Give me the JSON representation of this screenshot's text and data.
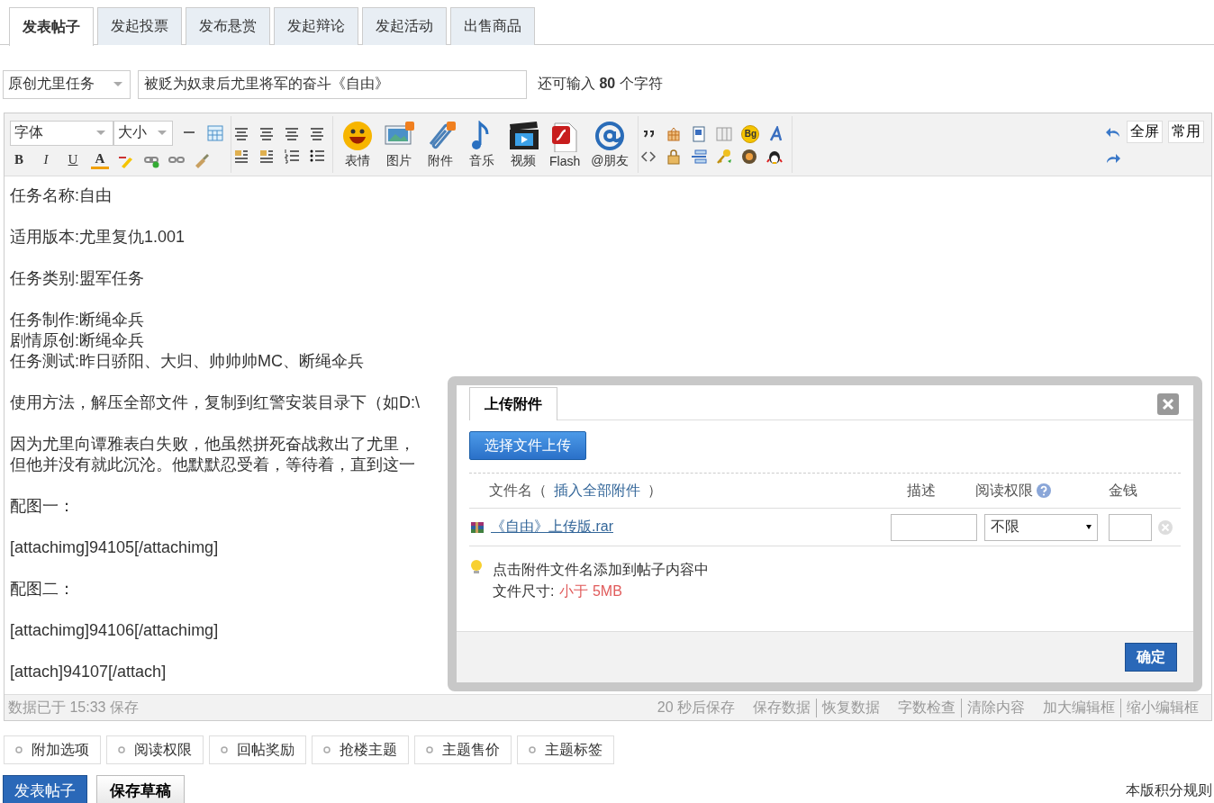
{
  "tabs": [
    {
      "label": "发表帖子",
      "selected": true
    },
    {
      "label": "发起投票",
      "selected": false
    },
    {
      "label": "发布悬赏",
      "selected": false
    },
    {
      "label": "发起辩论",
      "selected": false
    },
    {
      "label": "发起活动",
      "selected": false
    },
    {
      "label": "出售商品",
      "selected": false
    }
  ],
  "title_row": {
    "category": "原创尤里任务",
    "title": "被贬为奴隶后尤里将军的奋斗《自由》",
    "counter": "还可输入 **80** 个字符"
  },
  "toolbar": {
    "font_select": "字体",
    "size_select": "大小",
    "format_keys": [
      "B",
      "I",
      "U",
      "A"
    ],
    "badge": "Bg",
    "media": [
      {
        "kind": "smiley",
        "label": "表情"
      },
      {
        "kind": "picture",
        "label": "图片"
      },
      {
        "kind": "clip",
        "label": "附件"
      },
      {
        "kind": "note",
        "label": "音乐"
      },
      {
        "kind": "film",
        "label": "视频"
      },
      {
        "kind": "flash",
        "label": "Flash"
      },
      {
        "kind": "at",
        "label": "@朋友"
      }
    ],
    "right_buttons": [
      "全屏",
      "常用"
    ]
  },
  "editor": [
    [
      "任务名称:自由"
    ],
    [
      "适用版本:尤里复仇1.001"
    ],
    [
      "任务类别:盟军任务"
    ],
    [
      "任务制作:断绳伞兵",
      "剧情原创:断绳伞兵",
      "任务测试:昨日骄阳、大归、帅帅帅MC、断绳伞兵"
    ],
    [
      "使用方法，解压全部文件，复制到红警安装目录下（如D:\\"
    ],
    [
      "因为尤里向谭雅表白失败，他虽然拼死奋战救出了尤里，",
      "但他并没有就此沉沦。他默默忍受着，等待着，直到这一"
    ],
    [
      "配图一："
    ],
    [
      "[attachimg]94105[/attachimg]"
    ],
    [
      "配图二："
    ],
    [
      "[attachimg]94106[/attachimg]"
    ],
    [
      "[attach]94107[/attach]"
    ]
  ],
  "status_bar": {
    "saved_note": "数据已于 15:33 保存",
    "autosave": "20 秒后保存",
    "link_groups": [
      [
        "保存数据",
        "恢复数据"
      ],
      [
        "字数检查",
        "清除内容"
      ],
      [
        "加大编辑框",
        "缩小编辑框"
      ]
    ]
  },
  "options": [
    "附加选项",
    "阅读权限",
    "回帖奖励",
    "抢楼主题",
    "主题售价",
    "主题标签"
  ],
  "actions": {
    "submit": "发表帖子",
    "draft": "保存草稿",
    "rules_link": "本版积分规则"
  },
  "dialog": {
    "tab": "上传附件",
    "upload_button": "选择文件上传",
    "columns": {
      "name_before": "文件名（",
      "name_link": "插入全部附件",
      "name_after": "）",
      "description": "描述",
      "permission": "阅读权限",
      "money": "金钱"
    },
    "files": [
      {
        "name": "《自由》上传版.rar",
        "permission": "不限"
      }
    ],
    "tip": "点击附件文件名添加到帖子内容中",
    "size_label": "文件尺寸:",
    "size_value": "小于 5MB",
    "ok": "确定"
  }
}
